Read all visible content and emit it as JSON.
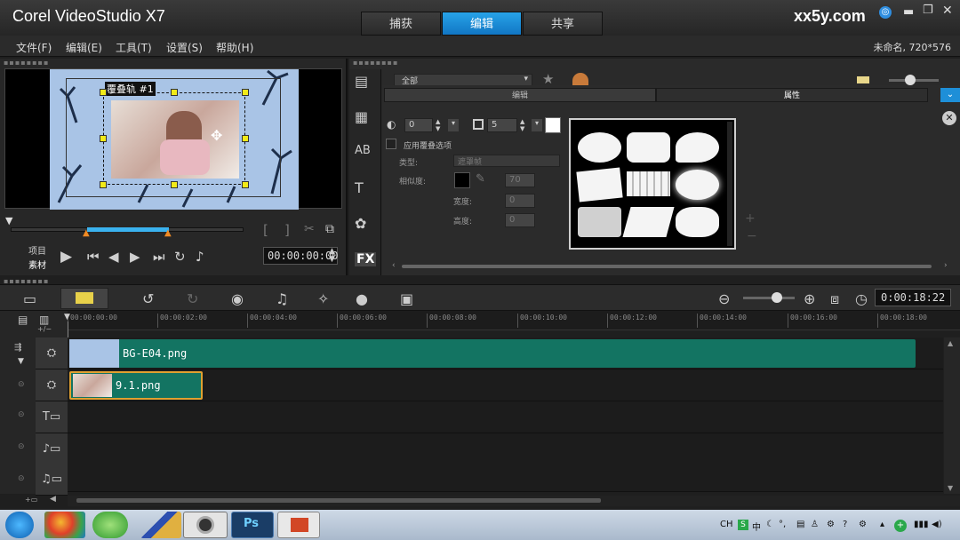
{
  "app": {
    "title": "Corel VideoStudio X7",
    "watermark": "xx5y.com"
  },
  "modes": [
    {
      "label": "捕获"
    },
    {
      "label": "编辑"
    },
    {
      "label": "共享"
    }
  ],
  "menu": [
    "文件(F)",
    "编辑(E)",
    "工具(T)",
    "设置(S)",
    "帮助(H)"
  ],
  "project_info": "未命名, 720*576",
  "preview": {
    "overlay_label": "覆叠轨 #1",
    "mode_project": "项目",
    "mode_clip": "素材",
    "timecode": "00:00:00:00",
    "start_bracket": "[",
    "end_bracket": "]"
  },
  "library": {
    "dropdown_value": "全部",
    "subtabs": [
      "编辑",
      "属性"
    ],
    "props": {
      "transparency": "0",
      "border": "5",
      "apply_overlay": "应用覆叠选项",
      "type_label": "类型:",
      "type_value": "遮罩帧",
      "similarity_label": "相似度:",
      "similarity_value": "70",
      "width_label": "宽度:",
      "width_value": "0",
      "height_label": "高度:",
      "height_value": "0"
    }
  },
  "sidebar_icons": [
    "media-icon",
    "transition-icon",
    "title-icon",
    "text-icon",
    "graphics-icon",
    "fx-icon"
  ],
  "timeline": {
    "duration": "0:00:18:22",
    "ruler": [
      "00:00:00:00",
      "00:00:02:00",
      "00:00:04:00",
      "00:00:06:00",
      "00:00:08:00",
      "00:00:10:00",
      "00:00:12:00",
      "00:00:14:00",
      "00:00:16:00",
      "00:00:18:00"
    ],
    "clips": [
      {
        "name": "BG-E04.png"
      },
      {
        "name": "9.1.png"
      }
    ]
  },
  "taskbar": {
    "tray": "CH"
  }
}
